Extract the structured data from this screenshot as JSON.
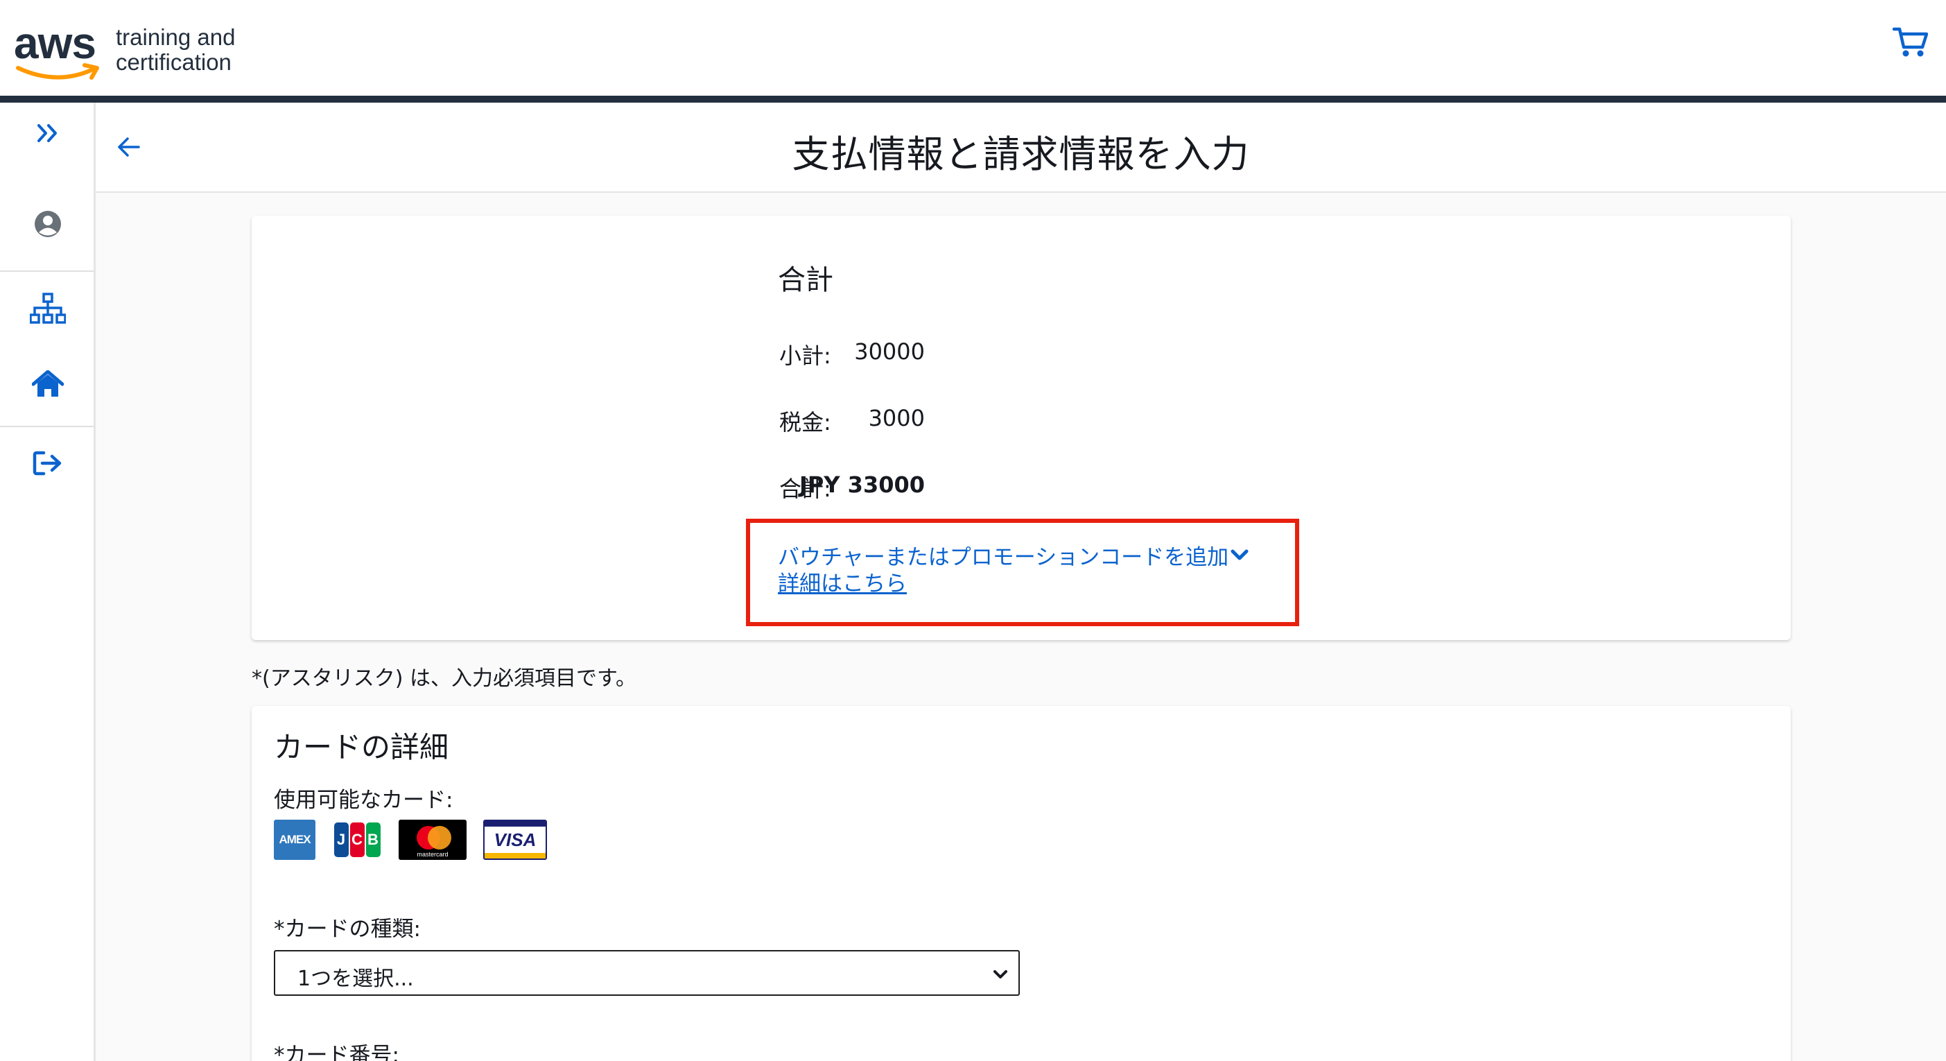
{
  "header": {
    "logo_main": "aws",
    "logo_sub_line1": "training and",
    "logo_sub_line2": "certification",
    "cart_icon": "shopping-cart-icon"
  },
  "sidebar": {
    "items": [
      {
        "icon": "expand-chevrons-icon"
      },
      {
        "icon": "user-circle-icon"
      },
      {
        "icon": "sitemap-icon"
      },
      {
        "icon": "home-icon"
      },
      {
        "icon": "sign-out-icon"
      }
    ]
  },
  "page": {
    "back_icon": "arrow-left-icon",
    "title": "支払情報と請求情報を入力"
  },
  "summary": {
    "heading": "合計",
    "rows": [
      {
        "label": "小計:",
        "value": "30000"
      },
      {
        "label": "税金:",
        "value": "3000"
      },
      {
        "label": "合計:",
        "value": "JPY 33000"
      }
    ],
    "promo_link": "バウチャーまたはプロモーションコードを追加",
    "more_link": "詳細はこちら"
  },
  "required_note": "*(アスタリスク) は、入力必須項目です。",
  "card_details": {
    "heading": "カードの詳細",
    "available_label": "使用可能なカード:",
    "brands": [
      "AMEX",
      "JCB",
      "mastercard",
      "VISA"
    ],
    "type_label": "*カードの種類:",
    "type_selected": "1つを選択...",
    "number_label": "*カード番号:"
  },
  "colors": {
    "accent_link": "#0b63ce",
    "highlight_box": "#e8200f",
    "header_line": "#232f3e"
  }
}
